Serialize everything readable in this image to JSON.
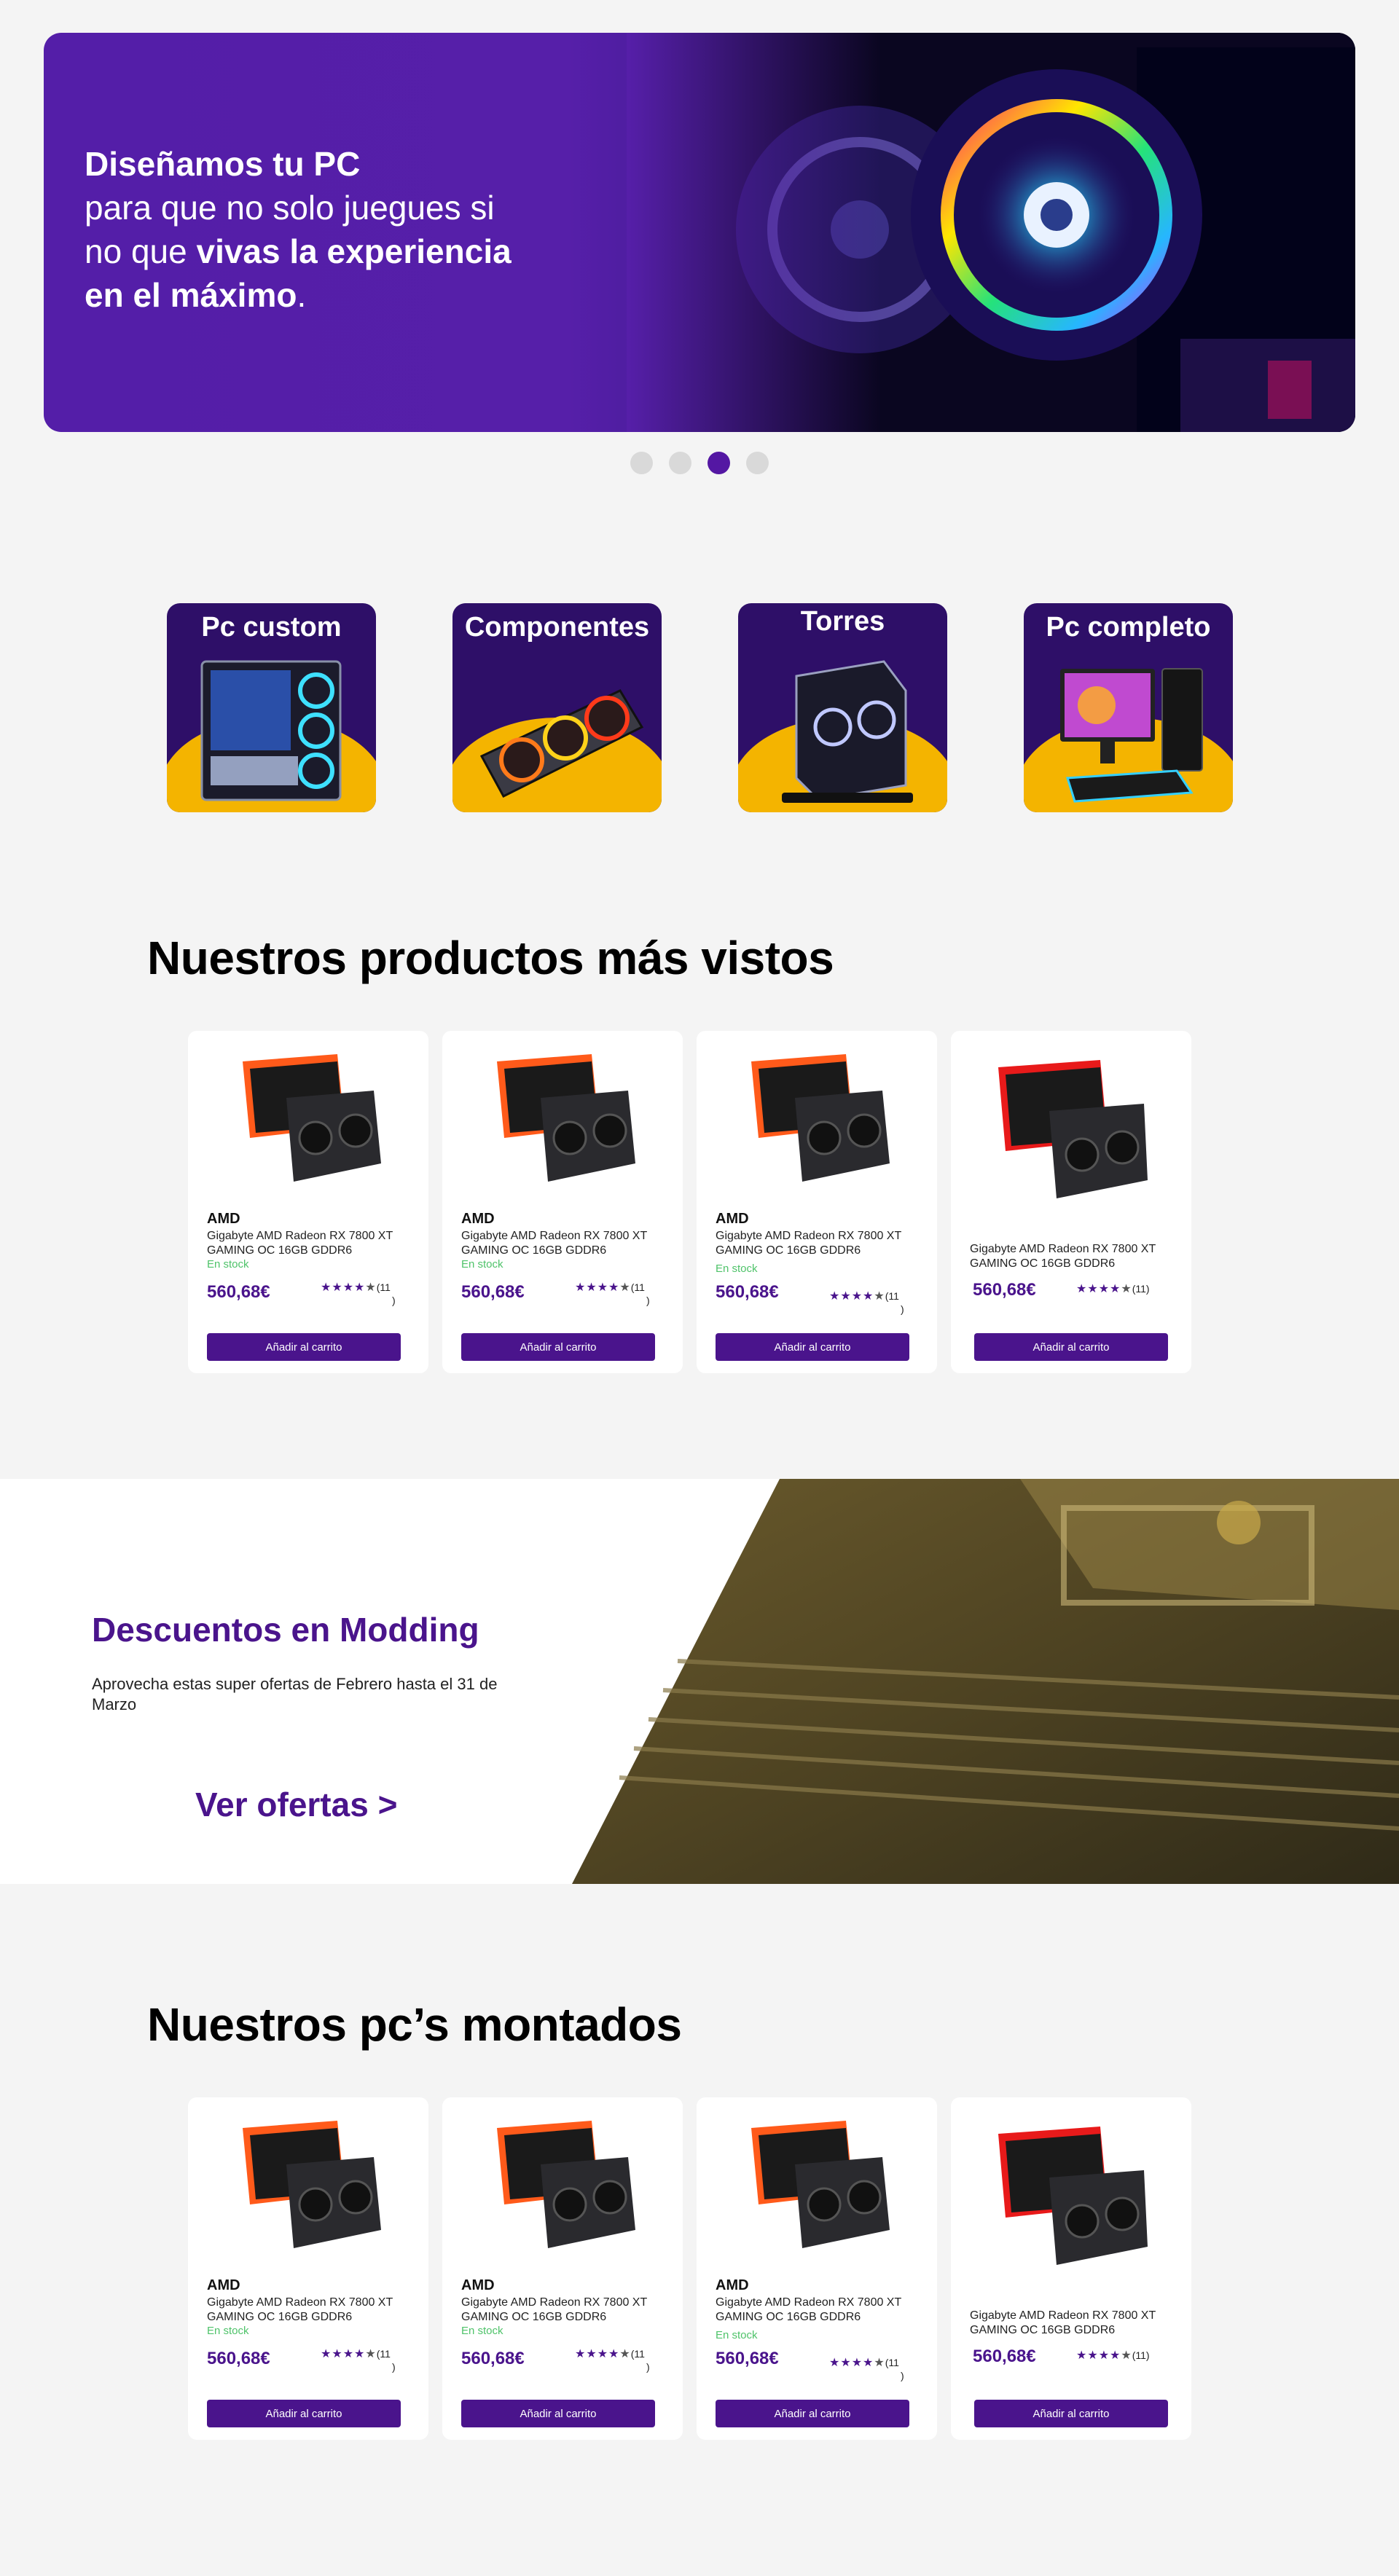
{
  "hero": {
    "line1_bold": "Diseñamos tu PC",
    "line2": "para que no solo juegues si",
    "line3_pre": "no que ",
    "line3_bold": "vivas la experiencia",
    "line4_bold": "en el máximo",
    "line4_post": "."
  },
  "carousel": {
    "active_index": 2,
    "total": 4
  },
  "categories": [
    {
      "label": "Pc custom",
      "icon": "pc-case-icon"
    },
    {
      "label": "Componentes",
      "icon": "graphics-card-icon"
    },
    {
      "label": "Torres",
      "icon": "tower-icon"
    },
    {
      "label": "Pc completo",
      "icon": "desktop-setup-icon"
    }
  ],
  "sections": {
    "most_viewed": "Nuestros productos más vistos",
    "mounted": "Nuestros pc’s montados"
  },
  "products": [
    {
      "brand": "AMD",
      "name": "Gigabyte AMD Radeon RX 7800 XT GAMING OC 16GB GDDR6",
      "stock": "En stock",
      "price": "560,68€",
      "rating": 4,
      "reviews_a": "(11",
      "reviews_b": ")",
      "button": "Añadir al carrito"
    },
    {
      "brand": "AMD",
      "name": "Gigabyte AMD Radeon RX 7800 XT GAMING OC 16GB GDDR6",
      "stock": "En stock",
      "price": "560,68€",
      "rating": 4,
      "reviews_a": "(11",
      "reviews_b": ")",
      "button": "Añadir al carrito"
    },
    {
      "brand": "AMD",
      "name": "Gigabyte AMD Radeon RX 7800 XT GAMING OC 16GB GDDR6",
      "stock": "En stock",
      "price": "560,68€",
      "rating": 4,
      "reviews_a": "(11",
      "reviews_b": ")",
      "button": "Añadir al carrito"
    },
    {
      "brand": "",
      "name": "Gigabyte AMD Radeon RX 7800 XT GAMING OC 16GB GDDR6",
      "stock": "",
      "price": "560,68€",
      "rating": 4,
      "reviews_a": "(11)",
      "reviews_b": "",
      "button": "Añadir al carrito"
    }
  ],
  "promo": {
    "title": "Descuentos en Modding",
    "text": "Aprovecha estas super ofertas de Febrero hasta el 31 de Marzo",
    "link": "Ver ofertas >"
  },
  "colors": {
    "brand": "#4a148c",
    "accent": "#f4b400",
    "stock": "#4fc36a"
  }
}
